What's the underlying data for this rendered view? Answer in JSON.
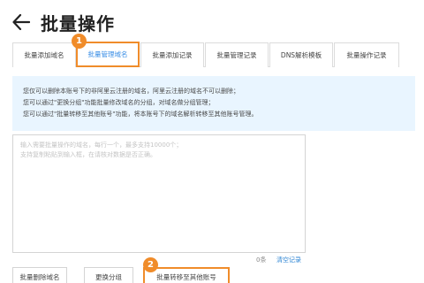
{
  "header": {
    "title": "批量操作",
    "back_icon": "arrow-left-icon"
  },
  "tabs": [
    {
      "label": "批量添加域名",
      "active": false
    },
    {
      "label": "批量管理域名",
      "active": true
    },
    {
      "label": "批量添加记录",
      "active": false
    },
    {
      "label": "批量管理记录",
      "active": false
    },
    {
      "label": "DNS解析模板",
      "active": false
    },
    {
      "label": "批量操作记录",
      "active": false
    }
  ],
  "badges": {
    "one": "1",
    "two": "2"
  },
  "notice": {
    "lines": [
      "您仅可以删除本账号下的非阿里云注册的域名，阿里云注册的域名不可以删除；",
      "您可以通过\"更换分组\"功能批量修改域名的分组，对域名做分组管理；",
      "您可以通过\"批量转移至其他账号\"功能，将本账号下的域名解析转移至其他账号管理。"
    ]
  },
  "textarea": {
    "placeholder_lines": [
      "输入需要批量操作的域名，每行一个，最多支持10000个；",
      "支持复制粘贴到输入框，在请核对数据是否正确。"
    ]
  },
  "counter": {
    "text": "0条"
  },
  "clear_label": "清空记录",
  "actions": {
    "delete_label": "批量删除域名",
    "group_label": "更换分组",
    "transfer_label": "批量转移至其他账号"
  },
  "colors": {
    "accent": "#f08c2a",
    "link": "#2f86d4",
    "notice_bg": "#e9f5ff"
  }
}
